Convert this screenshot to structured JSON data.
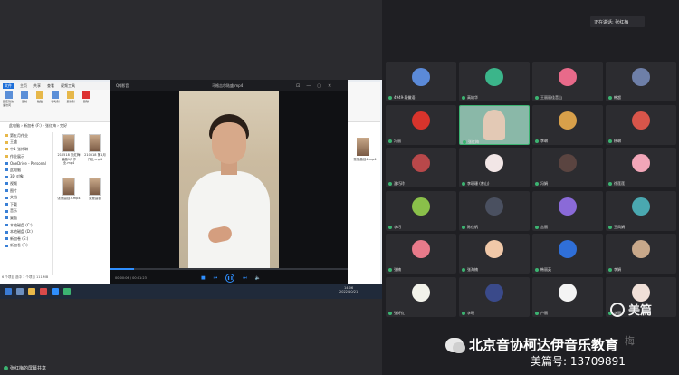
{
  "speaker": {
    "label": "正在讲话: 张红梅"
  },
  "share": {
    "label": "张红梅的屏幕共享",
    "explorer": {
      "tabs": [
        "文件",
        "主页",
        "共享",
        "查看",
        "视频工具"
      ],
      "ribbon": [
        {
          "label": "固定到快速访问",
          "icon": "pin-icon"
        },
        {
          "label": "复制",
          "icon": "copy-icon"
        },
        {
          "label": "粘贴",
          "icon": "paste-icon"
        },
        {
          "label": "移动到",
          "icon": "move-icon"
        },
        {
          "label": "复制到",
          "icon": "copy-to-icon"
        },
        {
          "label": "删除",
          "icon": "delete-icon"
        }
      ],
      "address": "此电脑 › 新加卷 (F:) › 张红梅 › 完好",
      "nav": [
        {
          "label": "第五月作业",
          "type": "folder"
        },
        {
          "label": "王盛",
          "type": "folder"
        },
        {
          "label": "中1-张炜琳",
          "type": "folder"
        },
        {
          "label": "作业展示",
          "type": "folder"
        },
        {
          "label": "OneDrive - Personal",
          "type": "cloud"
        },
        {
          "label": "此电脑",
          "type": "pc"
        },
        {
          "label": "3D 对象",
          "type": "item"
        },
        {
          "label": "视频",
          "type": "item"
        },
        {
          "label": "图片",
          "type": "item"
        },
        {
          "label": "文档",
          "type": "item"
        },
        {
          "label": "下载",
          "type": "item"
        },
        {
          "label": "音乐",
          "type": "item"
        },
        {
          "label": "桌面",
          "type": "item"
        },
        {
          "label": "本地磁盘 (C:)",
          "type": "drive"
        },
        {
          "label": "本地磁盘 (D:)",
          "type": "drive"
        },
        {
          "label": "新加卷 (E:)",
          "type": "drive"
        },
        {
          "label": "新加卷 (F:)",
          "type": "drive"
        }
      ],
      "files": [
        {
          "name": "210518 张红梅编曲1月作业.mp4"
        },
        {
          "name": "210518 第1月作业.mp4"
        },
        {
          "name": "张曼曲目3.mp4"
        },
        {
          "name": "张曼曲目"
        }
      ],
      "status": "6 个项目  选中 1 个项目 111 MB"
    },
    "player": {
      "app": "QQ影音",
      "filename": "马格吉尔陆盛.mp4",
      "time": "00:00:06 / 00:01:23",
      "progress": 0.1
    },
    "explorer2": {
      "file": "张曼曲目4.mp4"
    },
    "taskbar": {
      "time": "14:06",
      "date": "2022/10/21"
    }
  },
  "gallery": [
    {
      "name": "4949·段徽语",
      "avatar": "#5b8ad8"
    },
    {
      "name": "高雄华",
      "avatar": "#3bb58a"
    },
    {
      "name": "王丽丽佳音山",
      "avatar": "#e86a8a"
    },
    {
      "name": "韩超",
      "avatar": "#6e7fa8"
    },
    {
      "name": "冯丽",
      "avatar": "#d8342c"
    },
    {
      "name": "张红梅",
      "avatar": "#8ab8a8",
      "active": true
    },
    {
      "name": "李琳",
      "avatar": "#d8a04a"
    },
    {
      "name": "杨琳",
      "avatar": "#d8554a"
    },
    {
      "name": "潘巧玲",
      "avatar": "#b8484a"
    },
    {
      "name": "李珊珊 (曾山)",
      "avatar": "#f2e6e6"
    },
    {
      "name": "冯娟",
      "avatar": "#5a4440"
    },
    {
      "name": "徐莲莲",
      "avatar": "#f2a6b8"
    },
    {
      "name": "李巧",
      "avatar": "#8ac04a"
    },
    {
      "name": "陈佳帆",
      "avatar": "#4a5060"
    },
    {
      "name": "宫丽",
      "avatar": "#8a6ad8"
    },
    {
      "name": "王凤娟",
      "avatar": "#4aa8b0"
    },
    {
      "name": "张楠",
      "avatar": "#e87a8a"
    },
    {
      "name": "张海楠",
      "avatar": "#f0c8a8"
    },
    {
      "name": "韩丽英",
      "avatar": "#2f6fd8"
    },
    {
      "name": "李娟",
      "avatar": "#c8a88a"
    },
    {
      "name": "张好红",
      "avatar": "#f2f2ea"
    },
    {
      "name": "李瑶",
      "avatar": "#3a4a8a"
    },
    {
      "name": "卢丽",
      "avatar": "#f4f4f4"
    },
    {
      "name": "李丽",
      "avatar": "#f0e0d8"
    }
  ],
  "watermark": {
    "brand": "美篇",
    "account_name": "北京音协柯达伊音乐教育",
    "account_id": "美篇号: 13709891",
    "faded": "梅"
  }
}
